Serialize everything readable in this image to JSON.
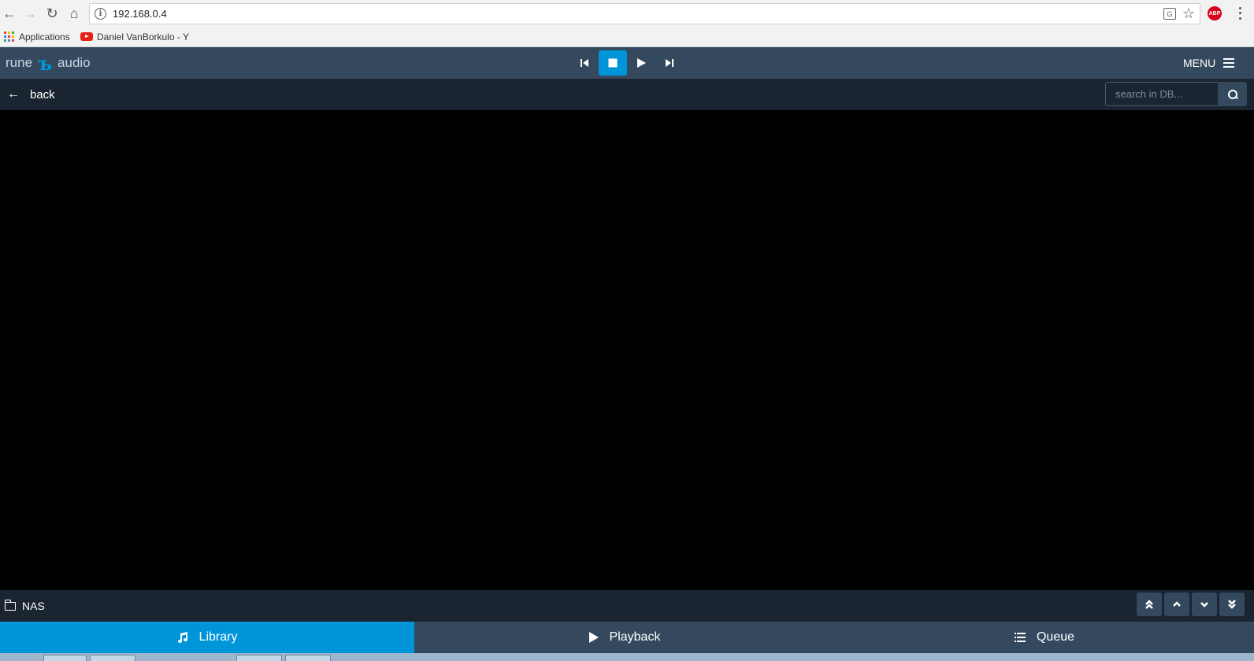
{
  "browser": {
    "url": "192.168.0.4",
    "bookmarks": [
      {
        "label": "Applications"
      },
      {
        "label": "Daniel VanBorkulo - Y"
      }
    ],
    "extension_badge": "ABP"
  },
  "header": {
    "logo_left": "rune",
    "logo_right": "audio",
    "menu_label": "MENU"
  },
  "subheader": {
    "back_label": "back",
    "search_placeholder": "search in DB..."
  },
  "path": {
    "current": "NAS"
  },
  "tabs": [
    {
      "label": "Library",
      "icon": "music-note-icon",
      "active": true
    },
    {
      "label": "Playback",
      "icon": "play-icon",
      "active": false
    },
    {
      "label": "Queue",
      "icon": "list-icon",
      "active": false
    }
  ],
  "colors": {
    "accent": "#0095d8",
    "header_bg": "#34495e",
    "subheader_bg": "#1b2531",
    "main_bg": "#000000"
  }
}
